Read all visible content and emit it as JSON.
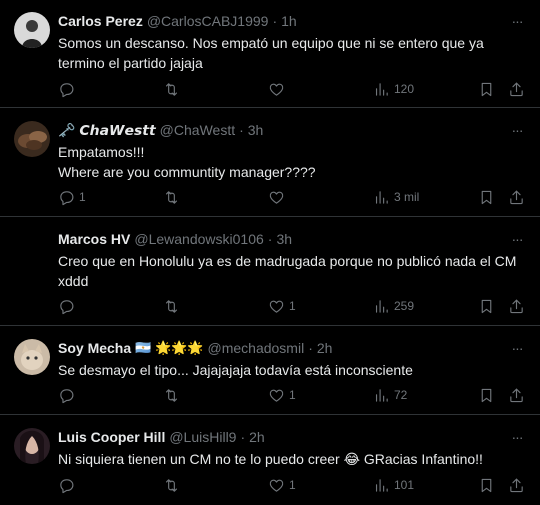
{
  "tweets": [
    {
      "name": "Carlos Perez",
      "handle": "@CarlosCABJ1999",
      "dot": "·",
      "time": "1h",
      "text": "Somos un descanso. Nos empató un equipo que ni se entero que ya termino el partido jajaja",
      "replies": "",
      "retweets": "",
      "likes": "",
      "views": "120",
      "avatar_color": "#d9d9d9"
    },
    {
      "name": "🗝️ 𝘾𝙝𝙖𝙒𝙚𝙨𝙩𝙩",
      "handle": "@ChaWestt",
      "dot": "·",
      "time": "3h",
      "text": "Empatamos!!!\nWhere are you communtity manager????",
      "replies": "1",
      "retweets": "",
      "likes": "",
      "views": "3 mil",
      "avatar_color": "#6b4a32"
    },
    {
      "name": "Marcos HV",
      "handle": "@Lewandowski0106",
      "dot": "·",
      "time": "3h",
      "text": "Creo que en Honolulu ya es de madrugada porque no publicó nada el CM xddd",
      "replies": "",
      "retweets": "",
      "likes": "1",
      "views": "259",
      "avatar_color": "#000000"
    },
    {
      "name": "Soy Mecha",
      "name_emoji": "🇦🇷 🌟🌟🌟",
      "handle": "@mechadosmil",
      "dot": "·",
      "time": "2h",
      "text": "Se desmayo el tipo... Jajajajaja todavía está inconsciente",
      "replies": "",
      "retweets": "",
      "likes": "1",
      "views": "72",
      "avatar_color": "#c9b8a4"
    },
    {
      "name": "Luis Cooper Hill",
      "handle": "@LuisHill9",
      "dot": "·",
      "time": "2h",
      "text": "Ni siquiera tienen un CM no te lo puedo creer 😂 GRacias Infantino!!",
      "replies": "",
      "retweets": "",
      "likes": "1",
      "views": "101",
      "avatar_color": "#3a2a35"
    }
  ],
  "icons": {
    "reply": "reply-icon",
    "retweet": "retweet-icon",
    "like": "heart-icon",
    "views": "views-icon",
    "bookmark": "bookmark-icon",
    "share": "share-icon",
    "more": "more-icon"
  },
  "more_glyph": "···"
}
